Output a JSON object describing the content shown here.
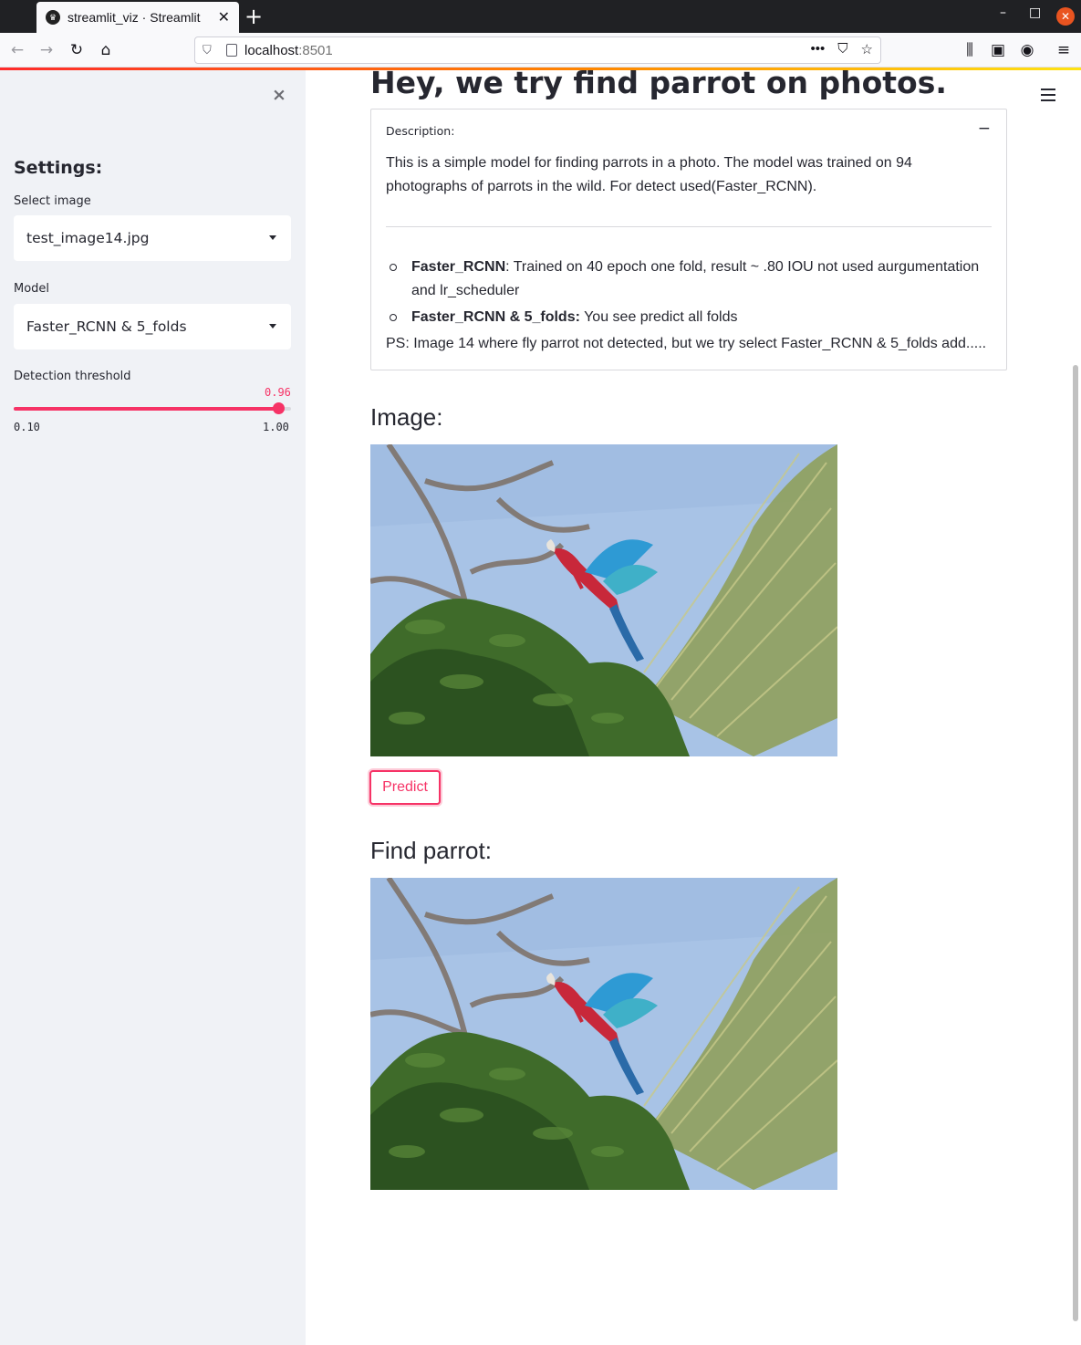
{
  "browser": {
    "tab_title": "streamlit_viz · Streamlit",
    "tab_close": "✕",
    "new_tab": "+",
    "url_host": "localhost",
    "url_port": ":8501"
  },
  "sidebar": {
    "close": "×",
    "title": "Settings:",
    "select_image_label": "Select image",
    "select_image_value": "test_image14.jpg",
    "model_label": "Model",
    "model_value": "Faster_RCNN & 5_folds",
    "threshold_label": "Detection threshold",
    "threshold_value": "0.96",
    "threshold_min": "0.10",
    "threshold_max": "1.00",
    "threshold_fraction": 0.96
  },
  "main": {
    "title": "Hey, we try find parrot on photos.",
    "expander": {
      "label": "Description:",
      "toggle": "−",
      "text": "This is a simple model for finding parrots in a photo. The model was trained on 94 photographs of parrots in the wild. For detect used(Faster_RCNN).",
      "items": [
        {
          "bold": "Faster_RCNN",
          "text": ": Trained on 40 epoch one fold, result ~ .80 IOU not used aurgumentation and lr_scheduler"
        },
        {
          "bold": "Faster_RCNN & 5_folds:",
          "text": " You see predict all folds"
        }
      ],
      "ps": "PS: Image 14 where fly parrot not detected, but we try select Faster_RCNN & 5_folds add....."
    },
    "image_heading": "Image:",
    "predict_button": "Predict",
    "result_heading": "Find parrot:"
  },
  "colors": {
    "accent": "#f63366",
    "sidebar_bg": "#f0f2f6",
    "text": "#262730"
  }
}
